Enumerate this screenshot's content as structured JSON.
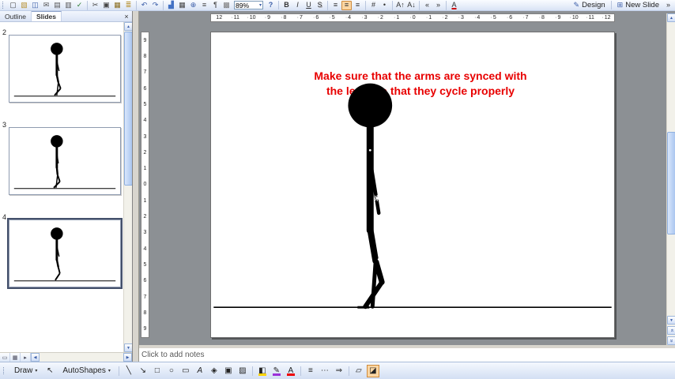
{
  "glyphs": {
    "up": "▲",
    "down": "▼",
    "left": "◀",
    "right": "▶",
    "chevron_down": "▾",
    "double_chevron": "«",
    "close": "×"
  },
  "toolbar": {
    "zoom_value": "89%",
    "design_label": "Design",
    "design_glyph": "✎",
    "new_slide_label": "New Slide",
    "new_slide_glyph": "⊞",
    "options_glyph": "»",
    "help_glyph": "?",
    "std_icons": [
      {
        "name": "new-icon",
        "glyph": "▢",
        "color": "#444444"
      },
      {
        "name": "open-icon",
        "glyph": "▧",
        "color": "#b8912f"
      },
      {
        "name": "save-icon",
        "glyph": "◫",
        "color": "#3a5da8"
      },
      {
        "name": "email-icon",
        "glyph": "✉",
        "color": "#555555"
      },
      {
        "name": "print-icon",
        "glyph": "▤",
        "color": "#555555"
      },
      {
        "name": "print-preview-icon",
        "glyph": "▥",
        "color": "#555555"
      },
      {
        "name": "spelling-icon",
        "glyph": "✓",
        "color": "#2e7d32"
      },
      {
        "sep": true
      },
      {
        "name": "cut-icon",
        "glyph": "✂",
        "color": "#444444"
      },
      {
        "name": "copy-icon",
        "glyph": "▣",
        "color": "#444444"
      },
      {
        "name": "paste-icon",
        "glyph": "▦",
        "color": "#8a6d1e"
      },
      {
        "name": "format-painter-icon",
        "glyph": "≣",
        "color": "#b8912f"
      },
      {
        "sep": true
      },
      {
        "name": "undo-icon",
        "glyph": "↶",
        "color": "#3a5da8"
      },
      {
        "name": "redo-icon",
        "glyph": "↷",
        "color": "#3a5da8"
      },
      {
        "sep": true
      },
      {
        "name": "insert-chart-icon",
        "glyph": "▟",
        "color": "#4472c4"
      },
      {
        "name": "insert-table-icon",
        "glyph": "▦",
        "color": "#444444"
      },
      {
        "name": "insert-hyperlink-icon",
        "glyph": "⊕",
        "color": "#3a5da8"
      },
      {
        "name": "expand-all-icon",
        "glyph": "≡",
        "color": "#444444"
      },
      {
        "name": "show-formatting-icon",
        "glyph": "¶",
        "color": "#444444"
      },
      {
        "name": "show-grid-icon",
        "glyph": "▩",
        "color": "#777777"
      }
    ],
    "fmt_icons": [
      {
        "name": "bold-button",
        "glyph": "B",
        "cls": "b"
      },
      {
        "name": "italic-button",
        "glyph": "I",
        "cls": "i"
      },
      {
        "name": "underline-button",
        "glyph": "U",
        "cls": "u"
      },
      {
        "name": "shadow-button",
        "glyph": "S",
        "cls": "s"
      },
      {
        "sep": true
      },
      {
        "name": "align-left-button",
        "glyph": "≡"
      },
      {
        "name": "align-center-button",
        "glyph": "≡",
        "active": true
      },
      {
        "name": "align-right-button",
        "glyph": "≡"
      },
      {
        "sep": true
      },
      {
        "name": "numbering-button",
        "glyph": "#"
      },
      {
        "name": "bullets-button",
        "glyph": "•"
      },
      {
        "sep": true
      },
      {
        "name": "increase-font-button",
        "glyph": "A↑"
      },
      {
        "name": "decrease-font-button",
        "glyph": "A↓"
      },
      {
        "sep": true
      },
      {
        "name": "decrease-indent-button",
        "glyph": "«"
      },
      {
        "name": "increase-indent-button",
        "glyph": "»"
      },
      {
        "sep": true
      },
      {
        "name": "font-color-button",
        "glyph": "A",
        "cls": "fontcolor"
      }
    ]
  },
  "pane": {
    "tabs": {
      "outline": "Outline",
      "slides": "Slides"
    },
    "slides": [
      {
        "number": "2"
      },
      {
        "number": "3"
      },
      {
        "number": "4"
      }
    ],
    "view_buttons": [
      {
        "name": "normal-view-button",
        "glyph": "▭"
      },
      {
        "name": "slide-sorter-view-button",
        "glyph": "▦"
      },
      {
        "name": "slideshow-button",
        "glyph": "▸"
      }
    ]
  },
  "rulers": {
    "horizontal": [
      "12",
      "11",
      "10",
      "9",
      "8",
      "7",
      "6",
      "5",
      "4",
      "3",
      "2",
      "1",
      "0",
      "1",
      "2",
      "3",
      "4",
      "5",
      "6",
      "7",
      "8",
      "9",
      "10",
      "11",
      "12"
    ],
    "vertical": [
      "9",
      "8",
      "7",
      "6",
      "5",
      "4",
      "3",
      "2",
      "1",
      "0",
      "1",
      "2",
      "3",
      "4",
      "5",
      "6",
      "7",
      "8",
      "9"
    ]
  },
  "slide": {
    "caption_line1": "Make sure that the arms are synced with",
    "caption_line2": "the legs, so that they cycle properly",
    "caption_color": "#e80000"
  },
  "notes": {
    "placeholder": "Click to add notes"
  },
  "drawbar": {
    "draw_label": "Draw",
    "autoshapes_label": "AutoShapes",
    "select_glyph": "↖",
    "icons": [
      {
        "sep": true
      },
      {
        "name": "line-button",
        "glyph": "╲"
      },
      {
        "name": "arrow-button",
        "glyph": "↘"
      },
      {
        "name": "rectangle-button",
        "glyph": "□"
      },
      {
        "name": "oval-button",
        "glyph": "○"
      },
      {
        "name": "text-box-button",
        "glyph": "▭"
      },
      {
        "name": "wordart-button",
        "glyph": "A",
        "cls": "i"
      },
      {
        "name": "diagram-button",
        "glyph": "◈"
      },
      {
        "name": "clip-art-button",
        "glyph": "▣"
      },
      {
        "name": "insert-picture-button",
        "glyph": "▨"
      },
      {
        "sep": true
      },
      {
        "name": "fill-color-button",
        "glyph": "◧",
        "bar": "#ffd400"
      },
      {
        "name": "line-color-button",
        "glyph": "✎",
        "bar": "#9b30d9"
      },
      {
        "name": "font-color-draw-button",
        "glyph": "A",
        "bar": "#ee0000"
      },
      {
        "sep": true
      },
      {
        "name": "line-style-button",
        "glyph": "≡"
      },
      {
        "name": "dash-style-button",
        "glyph": "⋯"
      },
      {
        "name": "arrow-style-button",
        "glyph": "⇒"
      },
      {
        "sep": true
      },
      {
        "name": "shadow-style-button",
        "glyph": "▱"
      },
      {
        "name": "3d-style-button",
        "glyph": "◪",
        "active": true
      }
    ]
  }
}
